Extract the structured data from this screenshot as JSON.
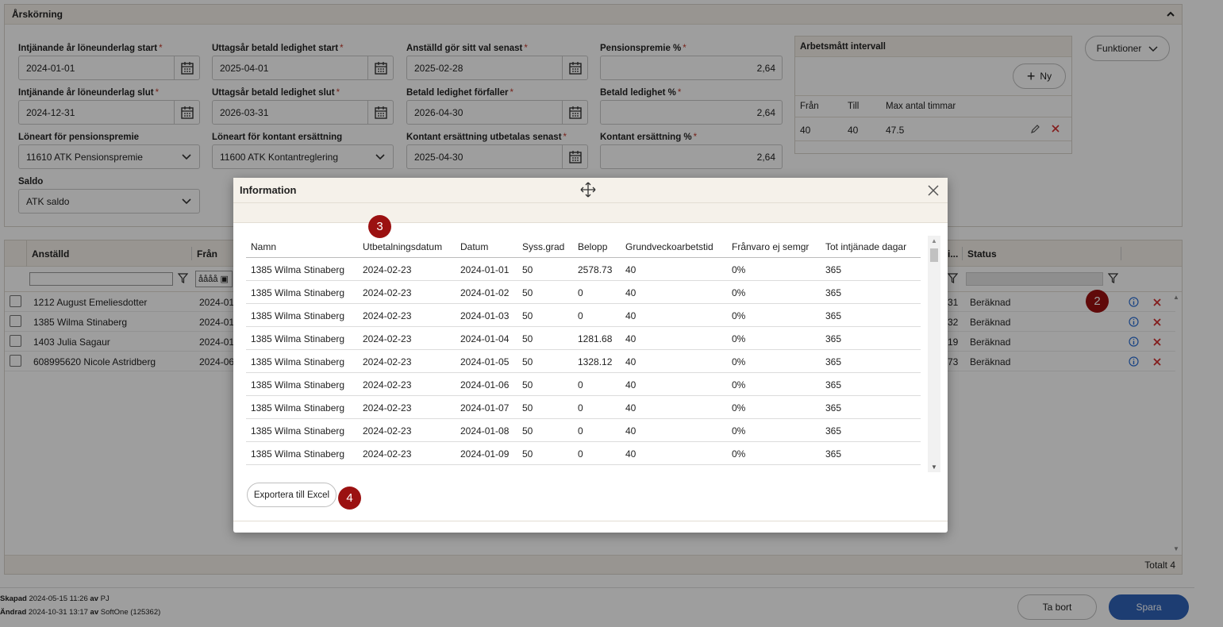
{
  "panel": {
    "title": "Årskörning",
    "fields": {
      "earn_start_label": "Intjänande år löneunderlag start",
      "earn_start_value": "2024-01-01",
      "earn_end_label": "Intjänande år löneunderlag slut",
      "earn_end_value": "2024-12-31",
      "pension_type_label": "Löneart för pensionspremie",
      "pension_type_value": "11610 ATK Pensionspremie",
      "saldo_label": "Saldo",
      "saldo_value": "ATK saldo",
      "withdraw_start_label": "Uttagsår betald ledighet start",
      "withdraw_start_value": "2025-04-01",
      "withdraw_end_label": "Uttagsår betald ledighet slut",
      "withdraw_end_value": "2026-03-31",
      "cash_type_label": "Löneart för kontant ersättning",
      "cash_type_value": "11600 ATK Kontantreglering",
      "choice_deadline_label": "Anställd gör sitt val senast",
      "choice_deadline_value": "2025-02-28",
      "leave_expires_label": "Betald ledighet förfaller",
      "leave_expires_value": "2026-04-30",
      "cash_paid_label": "Kontant ersättning utbetalas senast",
      "cash_paid_value": "2025-04-30",
      "pension_pct_label": "Pensionspremie %",
      "pension_pct_value": "2,64",
      "leave_pct_label": "Betald ledighet %",
      "leave_pct_value": "2,64",
      "cash_pct_label": "Kontant ersättning %",
      "cash_pct_value": "2,64",
      "required_mark": "*"
    },
    "interval": {
      "title": "Arbetsmått intervall",
      "new_label": "Ny",
      "columns": [
        "Från",
        "Till",
        "Max antal timmar"
      ],
      "row": [
        "40",
        "40",
        "47.5"
      ]
    },
    "functions_label": "Funktioner"
  },
  "grid": {
    "columns": {
      "employee": "Anställd",
      "from": "Från",
      "status": "Status",
      "status_partial": "i..."
    },
    "date_filter_placeholder": "åååå",
    "rows": [
      {
        "employee": "1212 August Emeliesdotter",
        "from": "2024-01-",
        "value": "31",
        "status": "Beräknad"
      },
      {
        "employee": "1385 Wilma Stinaberg",
        "from": "2024-01-",
        "value": "32",
        "status": "Beräknad"
      },
      {
        "employee": "1403 Julia Sagaur",
        "from": "2024-01-",
        "value": "19",
        "status": "Beräknad"
      },
      {
        "employee": "608995620 Nicole Astridberg",
        "from": "2024-06-",
        "value": "73",
        "status": "Beräknad"
      }
    ],
    "total": "Totalt 4"
  },
  "badges": {
    "b2": "2",
    "b3": "3",
    "b4": "4"
  },
  "modal": {
    "title": "Information",
    "columns": [
      "Namn",
      "Utbetalningsdatum",
      "Datum",
      "Syss.grad",
      "Belopp",
      "Grundveckoarbetstid",
      "Frånvaro ej semgr",
      "Tot intjänade dagar"
    ],
    "rows": [
      [
        "1385 Wilma Stinaberg",
        "2024-02-23",
        "2024-01-01",
        "50",
        "2578.73",
        "40",
        "0%",
        "365"
      ],
      [
        "1385 Wilma Stinaberg",
        "2024-02-23",
        "2024-01-02",
        "50",
        "0",
        "40",
        "0%",
        "365"
      ],
      [
        "1385 Wilma Stinaberg",
        "2024-02-23",
        "2024-01-03",
        "50",
        "0",
        "40",
        "0%",
        "365"
      ],
      [
        "1385 Wilma Stinaberg",
        "2024-02-23",
        "2024-01-04",
        "50",
        "1281.68",
        "40",
        "0%",
        "365"
      ],
      [
        "1385 Wilma Stinaberg",
        "2024-02-23",
        "2024-01-05",
        "50",
        "1328.12",
        "40",
        "0%",
        "365"
      ],
      [
        "1385 Wilma Stinaberg",
        "2024-02-23",
        "2024-01-06",
        "50",
        "0",
        "40",
        "0%",
        "365"
      ],
      [
        "1385 Wilma Stinaberg",
        "2024-02-23",
        "2024-01-07",
        "50",
        "0",
        "40",
        "0%",
        "365"
      ],
      [
        "1385 Wilma Stinaberg",
        "2024-02-23",
        "2024-01-08",
        "50",
        "0",
        "40",
        "0%",
        "365"
      ],
      [
        "1385 Wilma Stinaberg",
        "2024-02-23",
        "2024-01-09",
        "50",
        "0",
        "40",
        "0%",
        "365"
      ]
    ],
    "export_label": "Exportera till Excel"
  },
  "footer": {
    "created_label": "Skapad",
    "created_value": "2024-05-15 11:26",
    "by_label": "av",
    "created_by": "PJ",
    "changed_label": "Ändrad",
    "changed_value": "2024-10-31 13:17",
    "changed_by": "SoftOne (125362)",
    "delete_label": "Ta bort",
    "save_label": "Spara"
  },
  "colors": {
    "header_bg": "#f5f1ea",
    "badge": "#9b1111",
    "required": "#c0392b",
    "save_button": "#2f63b8",
    "info_icon": "#2a6fd6",
    "delete_icon": "#d32f2f"
  }
}
